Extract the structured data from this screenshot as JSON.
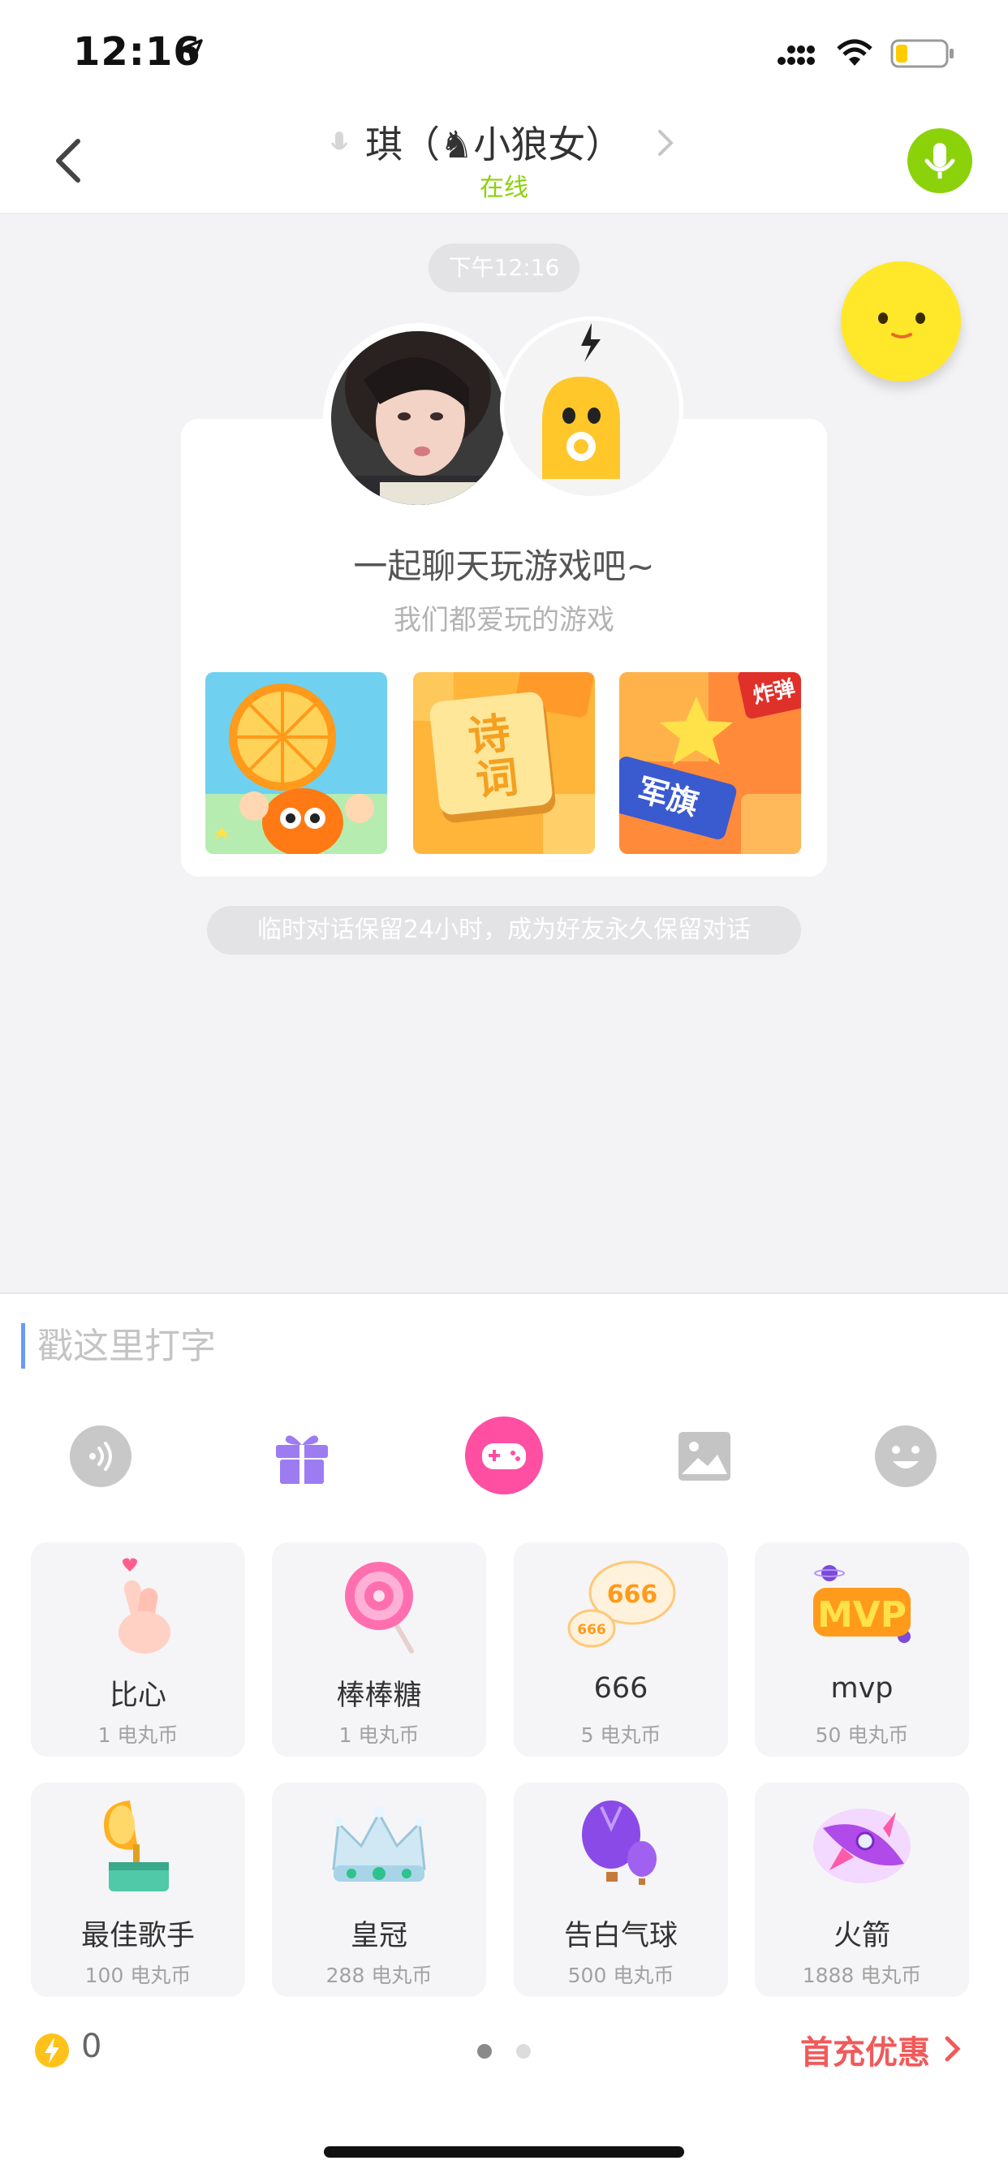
{
  "status_bar": {
    "time": "12:16"
  },
  "nav": {
    "title": "琪（♞小狼女）",
    "status": "在线"
  },
  "chat": {
    "timestamp": "下午12:16",
    "card_title": "一起聊天玩游戏吧~",
    "card_subtitle": "我们都爱玩的游戏",
    "games": [
      {
        "icon": "orange-game-tile"
      },
      {
        "icon": "poetry-game-tile",
        "label": "诗词"
      },
      {
        "icon": "army-chess-game-tile",
        "label": "军旗",
        "label2": "炸弹"
      }
    ],
    "notice": "临时对话保留24小时，成为好友永久保留对话"
  },
  "input": {
    "placeholder": "戳这里打字"
  },
  "toolbar": [
    "voice-icon",
    "gift-icon",
    "game-controller-icon",
    "image-icon",
    "emoji-icon"
  ],
  "gifts": [
    {
      "name": "比心",
      "price": "1 电丸币",
      "icon": "finger-heart-icon"
    },
    {
      "name": "棒棒糖",
      "price": "1 电丸币",
      "icon": "lollipop-icon"
    },
    {
      "name": "666",
      "price": "5 电丸币",
      "icon": "666-bubble-icon"
    },
    {
      "name": "mvp",
      "price": "50 电丸币",
      "icon": "mvp-badge-icon"
    },
    {
      "name": "最佳歌手",
      "price": "100 电丸币",
      "icon": "gramophone-icon"
    },
    {
      "name": "皇冠",
      "price": "288 电丸币",
      "icon": "crown-icon"
    },
    {
      "name": "告白气球",
      "price": "500 电丸币",
      "icon": "balloon-icon"
    },
    {
      "name": "火箭",
      "price": "1888 电丸币",
      "icon": "rocket-icon"
    }
  ],
  "mvp_text": "MVP",
  "bubble_big": "666",
  "bubble_small": "666",
  "wallet": {
    "balance": "0"
  },
  "recharge_label": "首充优惠",
  "colors": {
    "accent_green": "#8bd20a",
    "accent_pink": "#ff4fa3",
    "recharge_red": "#f05a5a"
  }
}
